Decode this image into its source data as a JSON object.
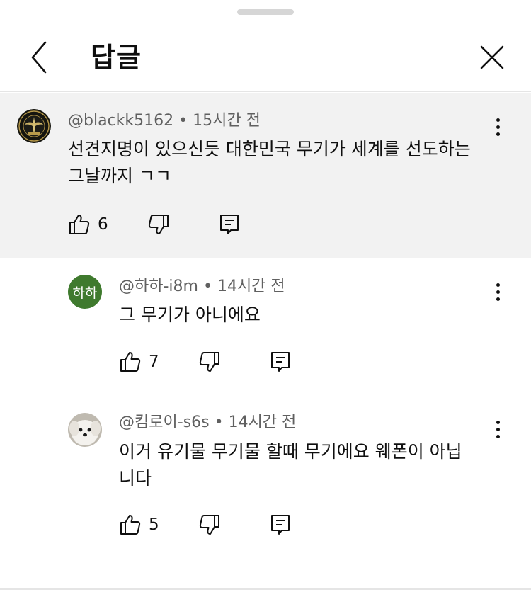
{
  "header": {
    "title": "답글"
  },
  "parent": {
    "author": "@blackk5162",
    "time": "15시간 전",
    "text_line1": "선견지명이 있으신듯 대한민국 무기가 세계를 선도하는",
    "text_line2": "그날까지 ㄱㄱ",
    "likes": "6"
  },
  "replies": [
    {
      "author": "@하하-i8m",
      "time": "14시간 전",
      "avatar_initials": "하하",
      "avatar_color": "#3f7a2e",
      "text_line1": "그 무기가 아니에요",
      "likes": "7"
    },
    {
      "author": "@킴로이-s6s",
      "time": "14시간 전",
      "text_line1": "이거 유기물 무기물 할때 무기에요 웨폰이 아닙",
      "text_line2": "니다",
      "likes": "5"
    }
  ],
  "separator": "•"
}
